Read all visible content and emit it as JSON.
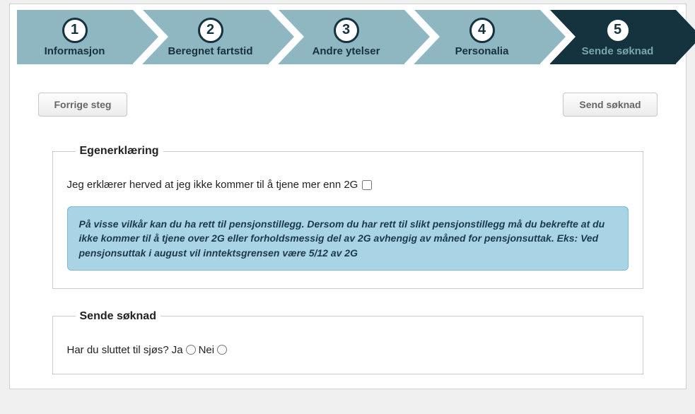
{
  "steps": [
    {
      "num": "1",
      "label": "Informasjon"
    },
    {
      "num": "2",
      "label": "Beregnet fartstid"
    },
    {
      "num": "3",
      "label": "Andre ytelser"
    },
    {
      "num": "4",
      "label": "Personalia"
    },
    {
      "num": "5",
      "label": "Sende søknad"
    }
  ],
  "nav": {
    "prev": "Forrige steg",
    "submit": "Send søknad"
  },
  "egenerklaering": {
    "legend": "Egenerklæring",
    "declaration": "Jeg erklærer herved at jeg ikke kommer til å tjene mer enn 2G",
    "info": "På visse vilkår kan du ha rett til pensjonstillegg. Dersom du har rett til slikt pensjonstillegg må du bekrefte at du ikke kommer til å tjene over 2G eller forholdsmessig del av 2G avhengig av måned for pensjonsuttak. Eks: Ved pensjonsuttak i august vil inntektsgrensen være 5/12 av 2G"
  },
  "sendesoknad": {
    "legend": "Sende søknad",
    "question": "Har du sluttet til sjøs?",
    "yes": "Ja",
    "no": "Nei"
  }
}
